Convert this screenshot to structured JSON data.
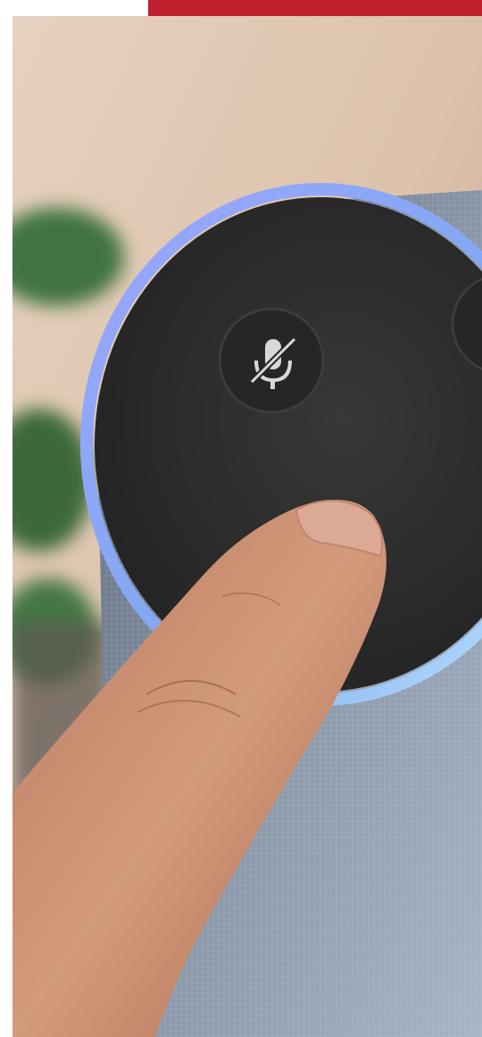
{
  "photo": {
    "subject_icons": [
      "microphone-mute-icon"
    ]
  },
  "colors": {
    "accent_red": "#C0202E",
    "background_beige": "#E4CDB9",
    "speaker_top": "#2B2B2B",
    "light_ring": "#8C9CF0",
    "fabric": "#7E8C9E",
    "skin": "#C98C6E",
    "plant_green": "#2F6B34"
  }
}
